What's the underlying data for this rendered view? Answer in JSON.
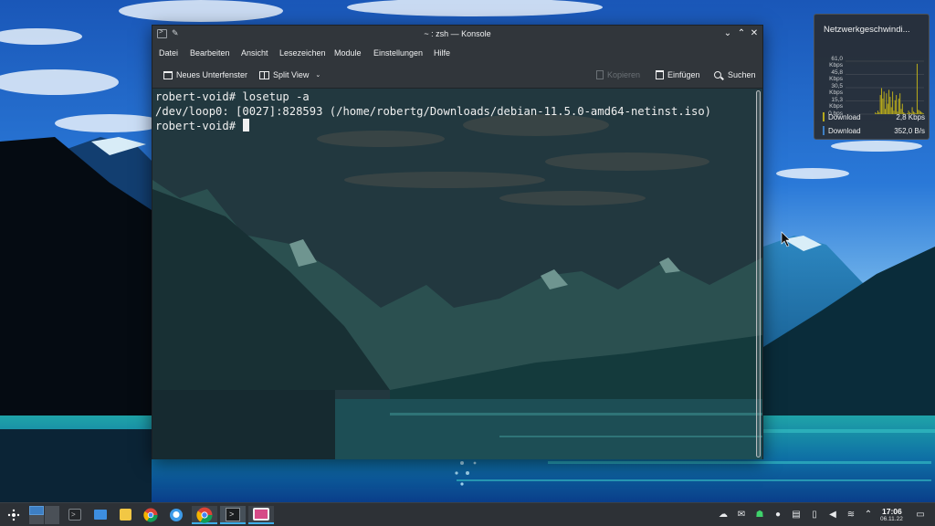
{
  "window": {
    "title": "~ : zsh — Konsole",
    "controls": [
      "minimize",
      "maximize",
      "close"
    ]
  },
  "menu": {
    "items": [
      "Datei",
      "Bearbeiten",
      "Ansicht",
      "Lesezeichen",
      "Module",
      "Einstellungen",
      "Hilfe"
    ]
  },
  "toolbar": {
    "new_tab": "Neues Unterfenster",
    "split_view": "Split View",
    "copy": "Kopieren",
    "paste": "Einfügen",
    "find": "Suchen"
  },
  "terminal": {
    "lines": [
      "robert-void# losetup -a",
      "/dev/loop0: [0027]:828593 (/home/robertg/Downloads/debian-11.5.0-amd64-netinst.iso)",
      "robert-void# "
    ]
  },
  "network_widget": {
    "title": "Netzwerkgeschwindi...",
    "y_ticks": [
      "61,0 Kbps",
      "45,8 Kbps",
      "30,5 Kbps",
      "15,3 Kbps",
      "0 bps"
    ],
    "legend": [
      {
        "label": "Download",
        "value": "2,8 Kbps",
        "color": "#b5a81c"
      },
      {
        "label": "Download",
        "value": "352,0 B/s",
        "color": "#3d7fc4"
      }
    ],
    "download_samples_kbps": [
      0,
      0,
      0,
      0,
      0,
      0,
      0,
      0,
      0,
      0,
      0,
      0,
      0,
      0,
      0,
      0,
      0,
      0,
      0,
      0,
      0,
      0,
      0,
      0,
      2,
      1,
      4,
      2,
      22,
      30,
      18,
      26,
      6,
      24,
      12,
      28,
      20,
      8,
      26,
      4,
      16,
      22,
      3,
      18,
      24,
      6,
      12,
      2,
      1,
      0,
      1,
      4,
      2,
      1,
      8,
      3,
      2,
      1,
      58,
      5,
      4,
      3,
      2,
      1
    ]
  },
  "taskbar": {
    "clock_time": "17:06",
    "clock_date": "06.11.22",
    "apps": [
      "application-launcher",
      "pager",
      "konsole-launcher",
      "dolphin",
      "notes",
      "chromium",
      "chat",
      "chrome",
      "konsole",
      "screenshot"
    ],
    "tray": [
      "ghost-icon",
      "mail-icon",
      "ghost-green-icon",
      "lightbulb-icon",
      "clipboard-icon",
      "battery-icon",
      "volume-icon",
      "wifi-icon",
      "chevron-up-icon"
    ]
  }
}
